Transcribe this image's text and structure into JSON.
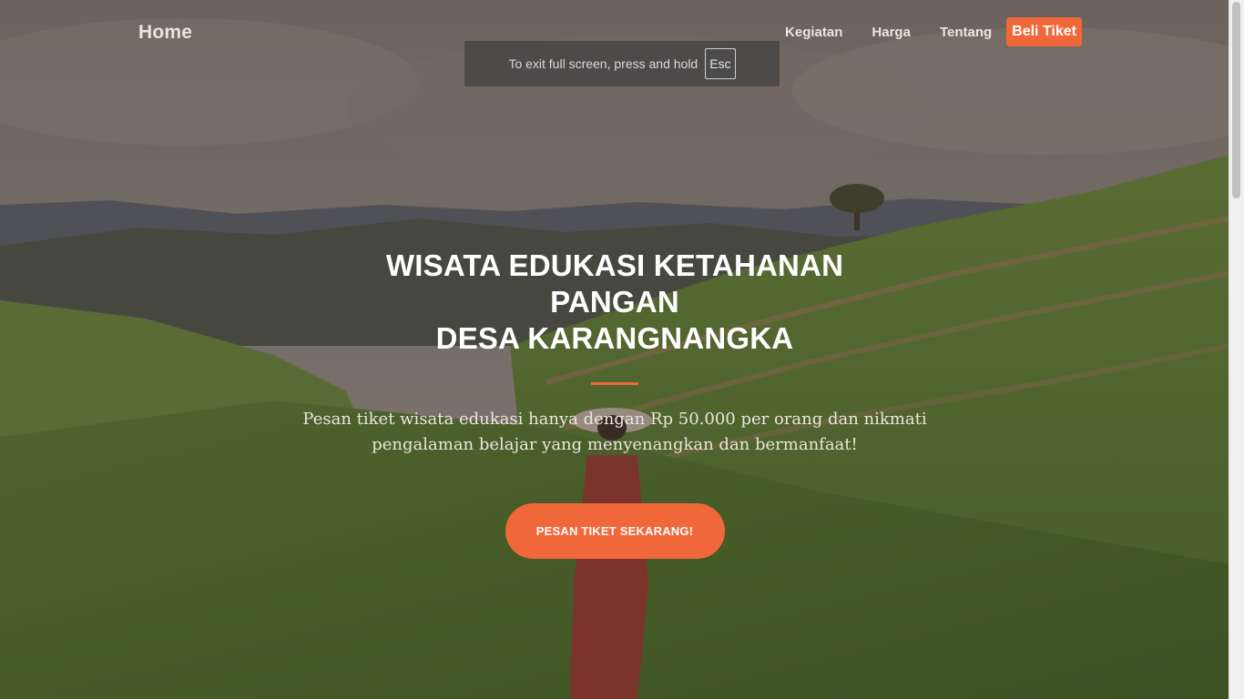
{
  "navbar": {
    "brand": "Home",
    "links": [
      "Kegiatan",
      "Harga",
      "Tentang"
    ],
    "cta": "Beli Tiket"
  },
  "fullscreen_notice": {
    "text": "To exit full screen, press and hold",
    "key": "Esc"
  },
  "hero": {
    "title_line1": "WISATA EDUKASI KETAHANAN PANGAN",
    "title_line2": "DESA KARANGNANGKA",
    "subtitle": "Pesan tiket wisata edukasi hanya dengan Rp 50.000 per orang dan nikmati pengalaman belajar yang menyenangkan dan bermanfaat!",
    "cta": "PESAN TIKET SEKARANG!"
  },
  "colors": {
    "accent": "#f0683a",
    "overlay": "#3c2d28"
  }
}
